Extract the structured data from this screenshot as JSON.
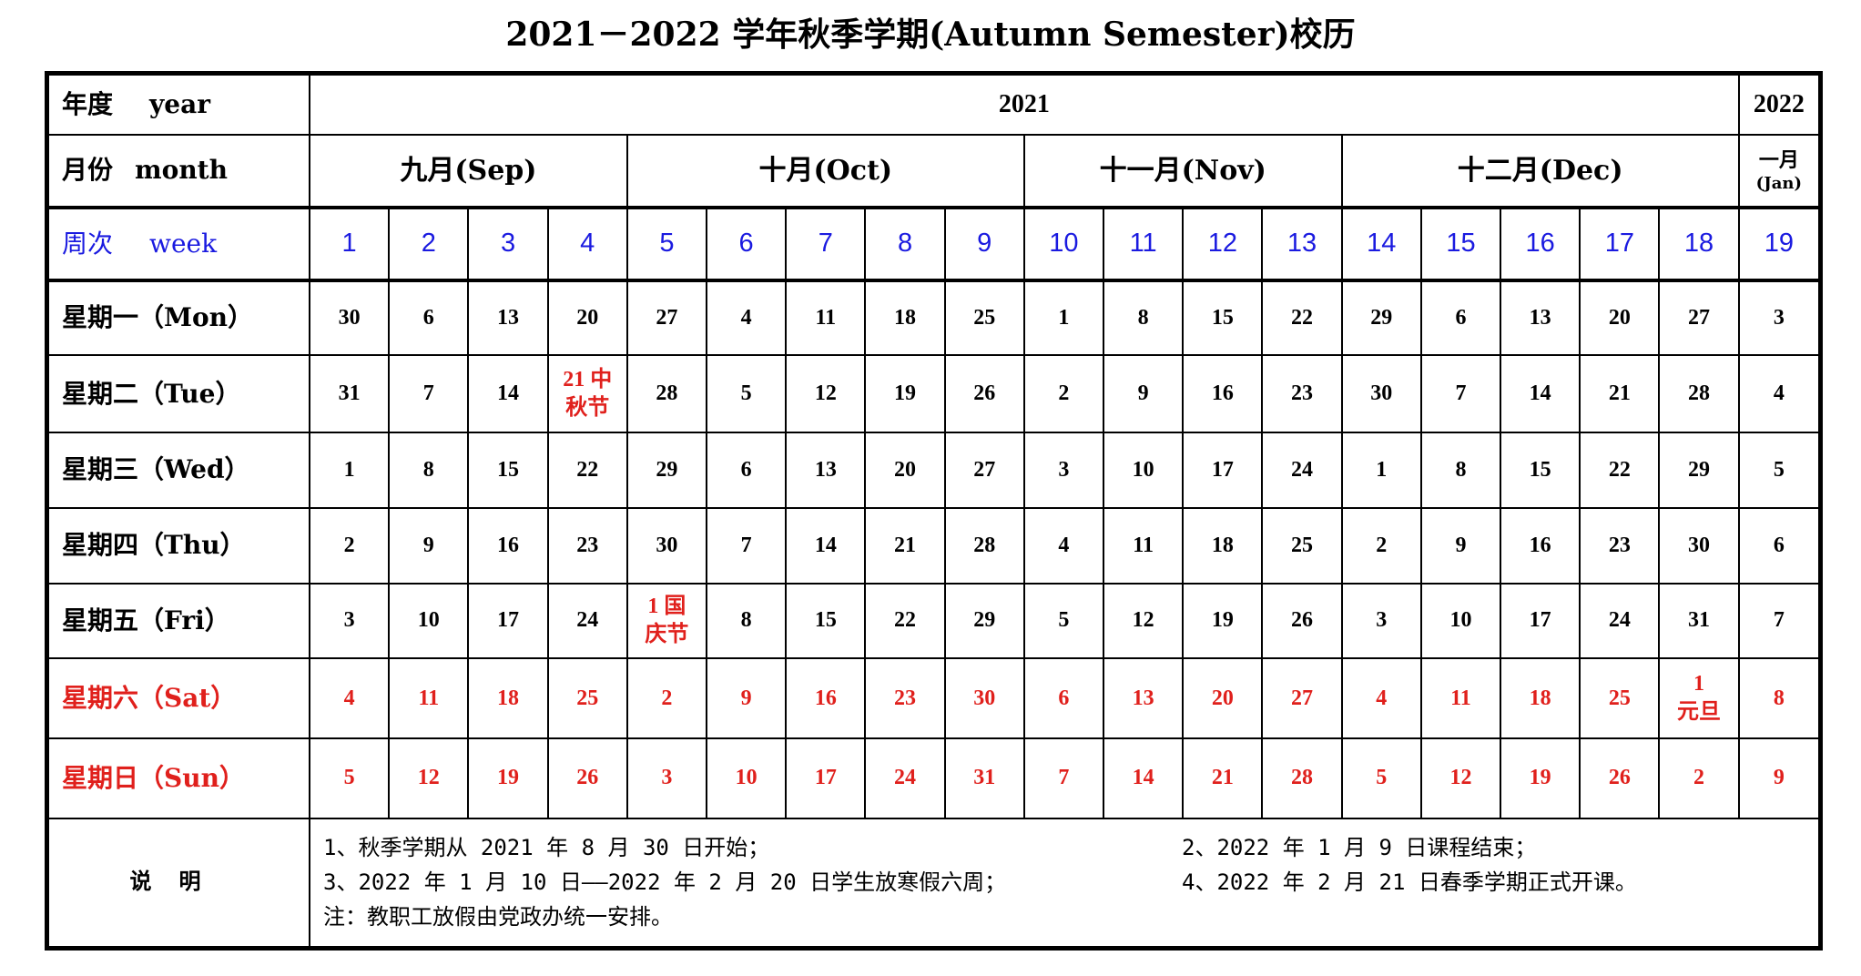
{
  "title": "2021－2022 学年秋季学期(Autumn Semester)校历",
  "labels": {
    "year_cn": "年度",
    "year_en": "year",
    "month_cn": "月份",
    "month_en": "month",
    "week_cn": "周次",
    "week_en": "week"
  },
  "years": [
    "2021",
    "2022"
  ],
  "months": [
    {
      "label": "九月(Sep)",
      "span": 4
    },
    {
      "label": "十月(Oct)",
      "span": 5
    },
    {
      "label": "十一月(Nov)",
      "span": 4
    },
    {
      "label": "十二月(Dec)",
      "span": 5
    }
  ],
  "jan_month": {
    "cn": "一月",
    "en": "(Jan)"
  },
  "weeks": [
    "1",
    "2",
    "3",
    "4",
    "5",
    "6",
    "7",
    "8",
    "9",
    "10",
    "11",
    "12",
    "13",
    "14",
    "15",
    "16",
    "17",
    "18",
    "19"
  ],
  "days": [
    {
      "label": "星期一（Mon）",
      "weekend": false,
      "dates": [
        "30",
        "6",
        "13",
        "20",
        "27",
        "4",
        "11",
        "18",
        "25",
        "1",
        "8",
        "15",
        "22",
        "29",
        "6",
        "13",
        "20",
        "27",
        "3"
      ]
    },
    {
      "label": "星期二（Tue）",
      "weekend": false,
      "dates": [
        "31",
        "7",
        "14",
        "21 中秋节",
        "28",
        "5",
        "12",
        "19",
        "26",
        "2",
        "9",
        "16",
        "23",
        "30",
        "7",
        "14",
        "21",
        "28",
        "4"
      ]
    },
    {
      "label": "星期三（Wed）",
      "weekend": false,
      "dates": [
        "1",
        "8",
        "15",
        "22",
        "29",
        "6",
        "13",
        "20",
        "27",
        "3",
        "10",
        "17",
        "24",
        "1",
        "8",
        "15",
        "22",
        "29",
        "5"
      ]
    },
    {
      "label": "星期四（Thu）",
      "weekend": false,
      "dates": [
        "2",
        "9",
        "16",
        "23",
        "30",
        "7",
        "14",
        "21",
        "28",
        "4",
        "11",
        "18",
        "25",
        "2",
        "9",
        "16",
        "23",
        "30",
        "6"
      ]
    },
    {
      "label": "星期五（Fri）",
      "weekend": false,
      "dates": [
        "3",
        "10",
        "17",
        "24",
        "1 国庆节",
        "8",
        "15",
        "22",
        "29",
        "5",
        "12",
        "19",
        "26",
        "3",
        "10",
        "17",
        "24",
        "31",
        "7"
      ]
    },
    {
      "label": "星期六（Sat）",
      "weekend": true,
      "dates": [
        "4",
        "11",
        "18",
        "25",
        "2",
        "9",
        "16",
        "23",
        "30",
        "6",
        "13",
        "20",
        "27",
        "4",
        "11",
        "18",
        "25",
        "1 元旦",
        "8"
      ]
    },
    {
      "label": "星期日（Sun）",
      "weekend": true,
      "dates": [
        "5",
        "12",
        "19",
        "26",
        "3",
        "10",
        "17",
        "24",
        "31",
        "7",
        "14",
        "21",
        "28",
        "5",
        "12",
        "19",
        "26",
        "2",
        "9"
      ]
    }
  ],
  "holidays": [
    {
      "row": 1,
      "col": 3,
      "line1": "21 中",
      "line2": "秋节"
    },
    {
      "row": 4,
      "col": 4,
      "line1": "1 国",
      "line2": "庆节"
    },
    {
      "row": 5,
      "col": 17,
      "line1": "1",
      "line2": "元旦"
    }
  ],
  "notes_label": "说明",
  "notes": [
    "1、秋季学期从 2021 年 8 月 30 日开始；",
    "2、2022 年 1 月 9 日课程结束；",
    "3、2022 年 1 月 10 日——2022 年 2 月 20 日学生放寒假六周；",
    "4、2022 年 2 月 21 日春季学期正式开课。",
    "注：教职工放假由党政办统一安排。"
  ],
  "colors": {
    "week_blue": "#1a1ae0",
    "holiday_red": "#e0201c"
  }
}
